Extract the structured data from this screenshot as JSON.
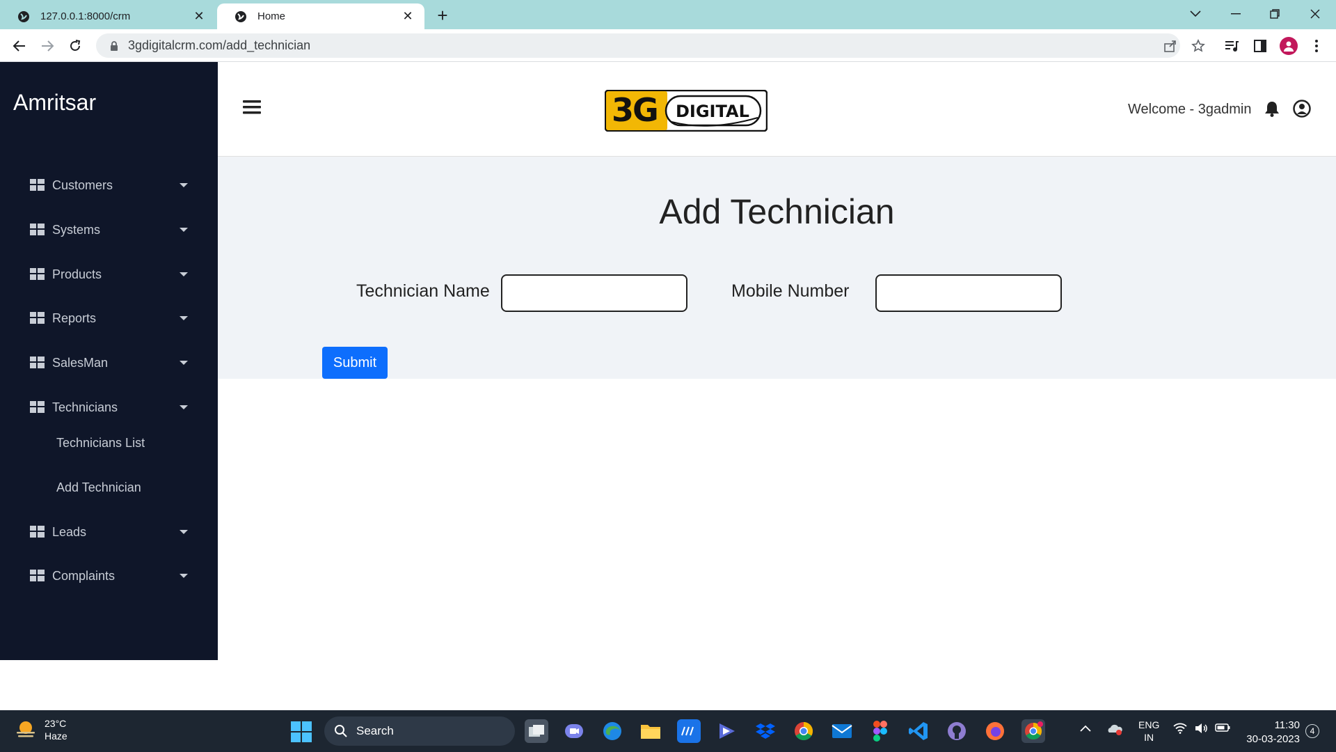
{
  "browser": {
    "tabs": [
      {
        "title": "127.0.0.1:8000/crm",
        "active": false
      },
      {
        "title": "Home",
        "active": true
      }
    ],
    "url": "3gdigitalcrm.com/add_technician"
  },
  "sidebar": {
    "brand": "Amritsar",
    "items": [
      {
        "label": "Customers"
      },
      {
        "label": "Systems"
      },
      {
        "label": "Products"
      },
      {
        "label": "Reports"
      },
      {
        "label": "SalesMan"
      },
      {
        "label": "Technicians"
      },
      {
        "label": "Leads"
      },
      {
        "label": "Complaints"
      }
    ],
    "technicians_sub": [
      {
        "label": "Technicians List"
      },
      {
        "label": "Add Technician"
      }
    ]
  },
  "header": {
    "logo_text_3g": "3G",
    "logo_text_digital": "DIGITAL",
    "welcome": "Welcome - 3gadmin"
  },
  "form": {
    "title": "Add Technician",
    "name_label": "Technician Name",
    "name_value": "",
    "mobile_label": "Mobile Number",
    "mobile_value": "",
    "submit_label": "Submit"
  },
  "taskbar": {
    "temp": "23°C",
    "condition": "Haze",
    "search_label": "Search",
    "lang_top": "ENG",
    "lang_bottom": "IN",
    "time": "11:30",
    "date": "30-03-2023",
    "notification_count": "4"
  },
  "colors": {
    "sidebar_bg": "#0f1629",
    "tab_strip": "#a8dadb",
    "accent_button": "#0d6efd",
    "content_bg": "#f0f3f7",
    "logo_yellow": "#f2b705"
  }
}
